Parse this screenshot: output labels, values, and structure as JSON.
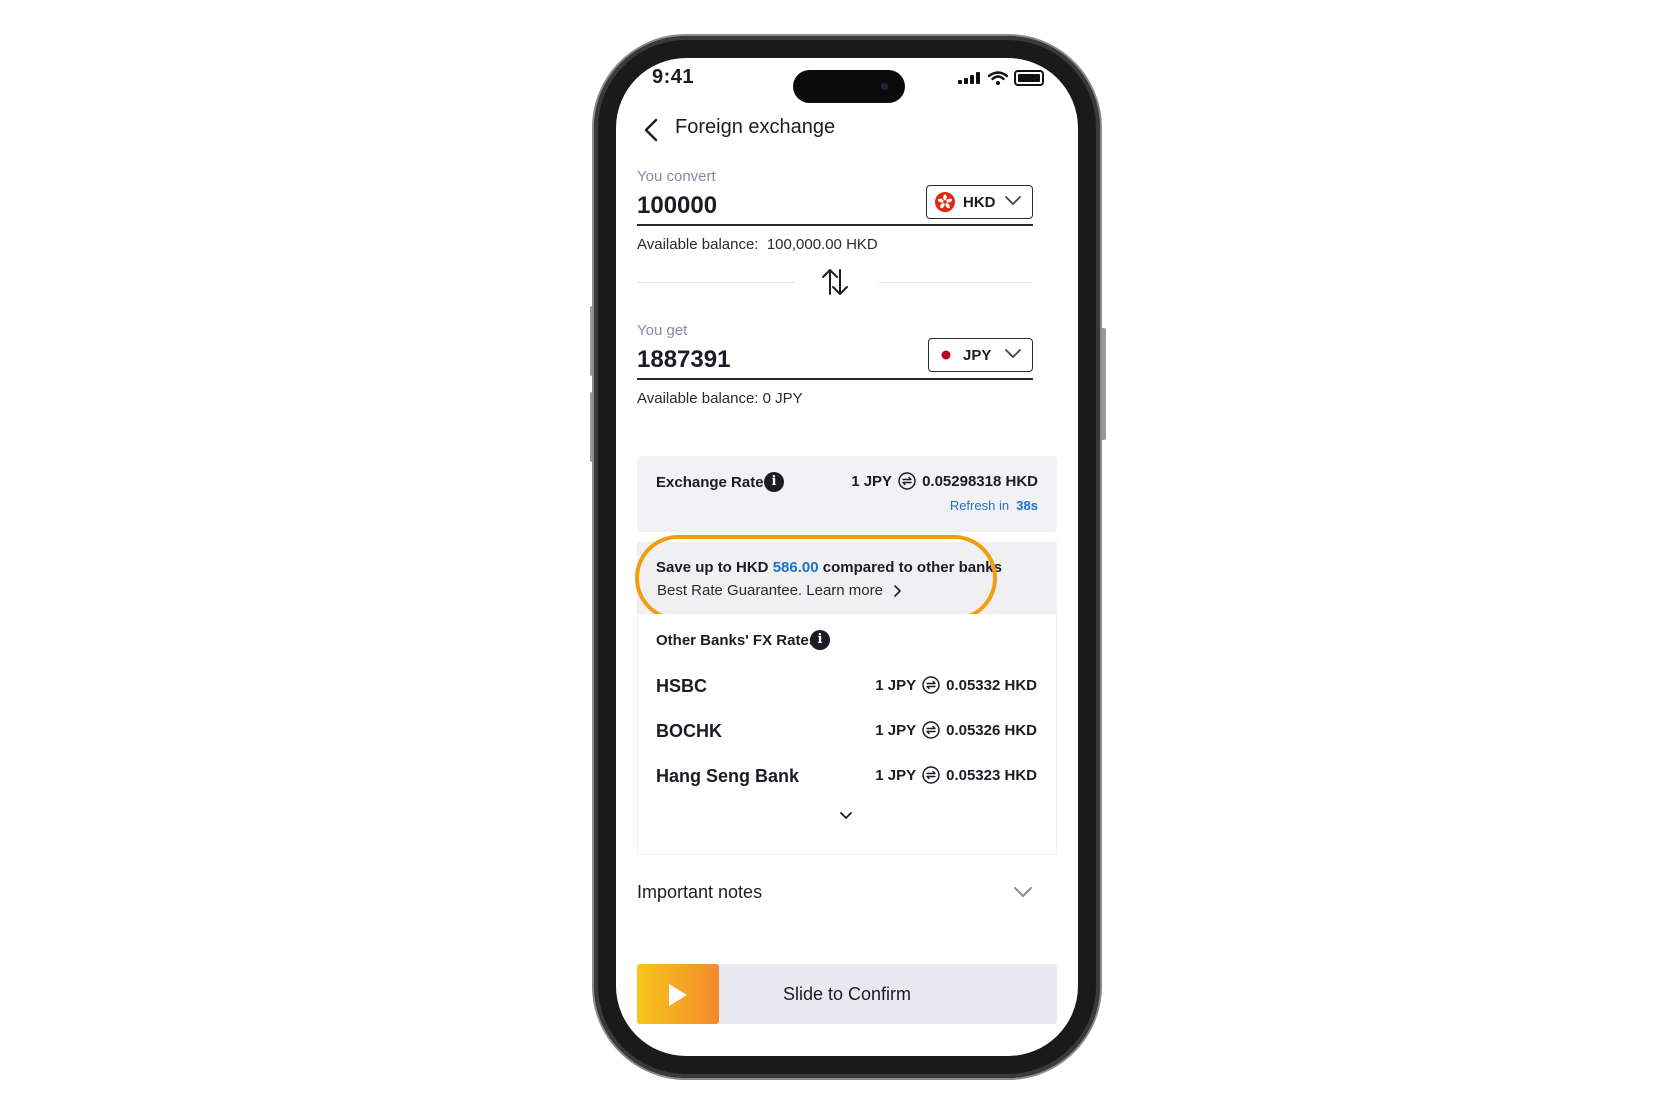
{
  "status_bar": {
    "time": "9:41"
  },
  "header": {
    "title": "Foreign exchange"
  },
  "convert": {
    "label": "You convert",
    "amount": "100000",
    "currency": "HKD",
    "balance_label": "Available balance:",
    "balance_value": "100,000.00 HKD"
  },
  "get": {
    "label": "You get",
    "amount": "1887391",
    "currency": "JPY",
    "balance": "Available balance: 0 JPY"
  },
  "exchange_rate": {
    "label": "Exchange Rate",
    "from": "1 JPY",
    "to": "0.05298318 HKD",
    "refresh_label": "Refresh in",
    "refresh_value": "38s"
  },
  "savings": {
    "prefix": "Save up to HKD",
    "amount": "586.00",
    "suffix": "compared to other banks",
    "link": "Best Rate Guarantee. Learn more"
  },
  "other_banks": {
    "title": "Other Banks' FX Rates",
    "rows": [
      {
        "name": "HSBC",
        "from": "1 JPY",
        "to": "0.05332 HKD"
      },
      {
        "name": "BOCHK",
        "from": "1 JPY",
        "to": "0.05326 HKD"
      },
      {
        "name": "Hang Seng Bank",
        "from": "1 JPY",
        "to": "0.05323 HKD"
      }
    ]
  },
  "notes": {
    "label": "Important notes"
  },
  "slider": {
    "label": "Slide to Confirm"
  },
  "colors": {
    "accent_blue": "#1a73c8",
    "highlight_orange": "#f39c12",
    "slider_start": "#f9c51d",
    "slider_end": "#f18a2a",
    "hk_flag": "#de2910",
    "jp_flag": "#bc002d"
  },
  "icons": {
    "back": "chevron-left-icon",
    "swap": "swap-vertical-icon",
    "info": "info-icon",
    "convert": "exchange-circle-icon",
    "expand": "chevron-down-icon",
    "learn_more": "chevron-right-icon",
    "confirm": "play-icon"
  }
}
